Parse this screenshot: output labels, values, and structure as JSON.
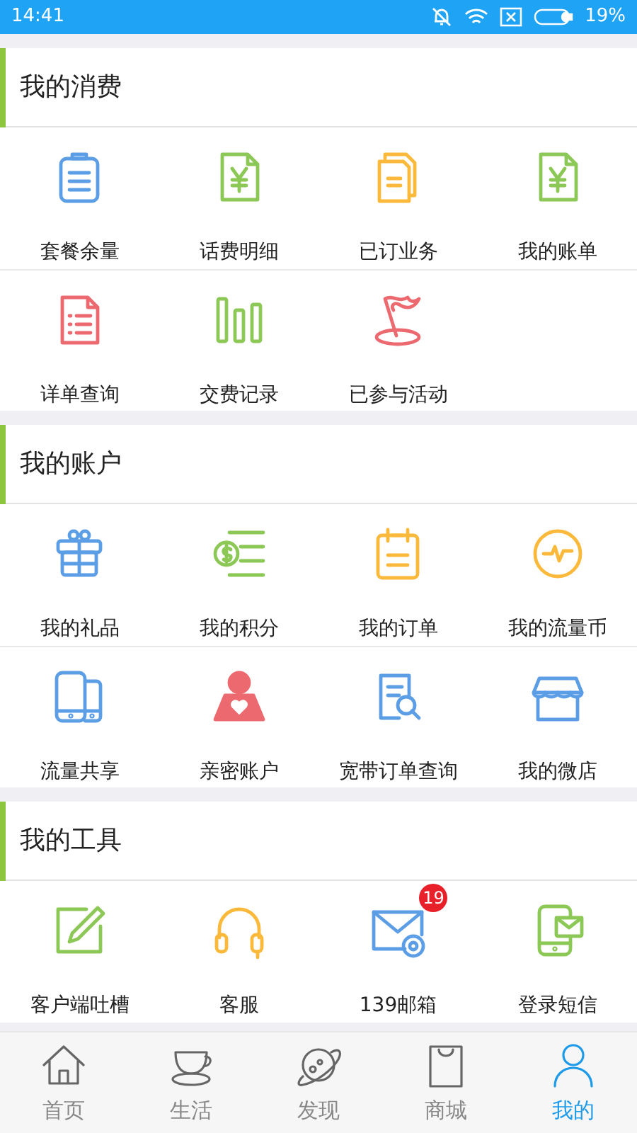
{
  "status_bar": {
    "time": "14:41",
    "battery": "19%"
  },
  "sections": [
    {
      "title": "我的消费",
      "items": [
        {
          "label": "套餐余量"
        },
        {
          "label": "话费明细"
        },
        {
          "label": "已订业务"
        },
        {
          "label": "我的账单"
        },
        {
          "label": "详单查询"
        },
        {
          "label": "交费记录"
        },
        {
          "label": "已参与活动"
        }
      ]
    },
    {
      "title": "我的账户",
      "items": [
        {
          "label": "我的礼品"
        },
        {
          "label": "我的积分"
        },
        {
          "label": "我的订单"
        },
        {
          "label": "我的流量币"
        },
        {
          "label": "流量共享"
        },
        {
          "label": "亲密账户"
        },
        {
          "label": "宽带订单查询"
        },
        {
          "label": "我的微店"
        }
      ]
    },
    {
      "title": "我的工具",
      "items": [
        {
          "label": "客户端吐槽"
        },
        {
          "label": "客服"
        },
        {
          "label": "139邮箱",
          "badge": "19"
        },
        {
          "label": "登录短信"
        }
      ]
    }
  ],
  "tab_bar": [
    {
      "label": "首页",
      "selected": false
    },
    {
      "label": "生活",
      "selected": false
    },
    {
      "label": "发现",
      "selected": false
    },
    {
      "label": "商城",
      "selected": false
    },
    {
      "label": "我的",
      "selected": true
    }
  ]
}
